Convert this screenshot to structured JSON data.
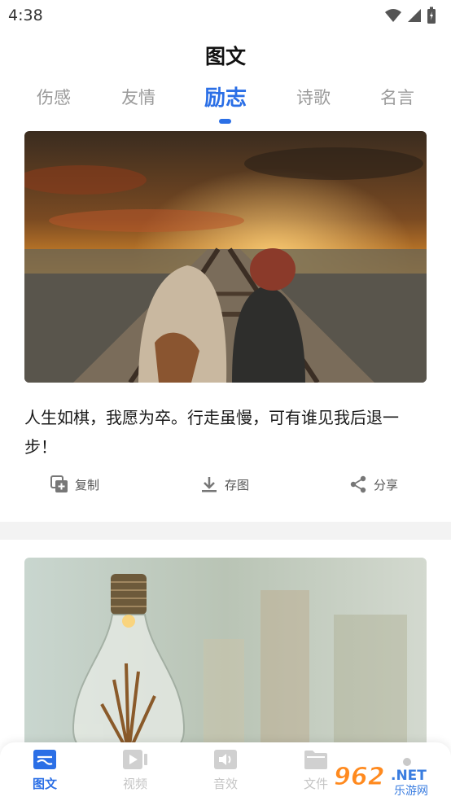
{
  "status_bar": {
    "time": "4:38"
  },
  "page": {
    "title": "图文"
  },
  "tabs": [
    {
      "label": "伤感"
    },
    {
      "label": "友情"
    },
    {
      "label": "励志"
    },
    {
      "label": "诗歌"
    },
    {
      "label": "名言"
    }
  ],
  "active_tab": "励志",
  "cards": [
    {
      "text": "人生如棋，我愿为卒。行走虽慢，可有谁见我后退一步！",
      "actions": {
        "copy": "复制",
        "save_image": "存图",
        "share": "分享"
      }
    }
  ],
  "bottom_nav": [
    {
      "label": "图文",
      "icon": "article-icon"
    },
    {
      "label": "视频",
      "icon": "video-icon"
    },
    {
      "label": "音效",
      "icon": "speaker-icon"
    },
    {
      "label": "文件",
      "icon": "folder-icon"
    }
  ],
  "watermark": {
    "number": "962",
    "suffix": ".NET",
    "subtitle": "乐游网"
  },
  "colors": {
    "accent": "#2b6fe6",
    "inactive": "#9a9a9a",
    "band": "#f3f3f3"
  }
}
